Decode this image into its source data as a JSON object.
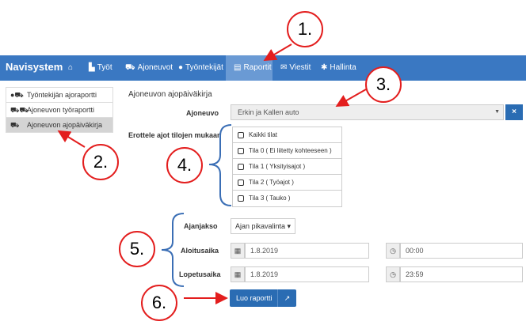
{
  "navbar": {
    "brand": "Navisystem",
    "items": [
      {
        "label": "",
        "icon": "home-icon",
        "glyph": "⌂"
      },
      {
        "label": "Työt",
        "icon": "chart-icon",
        "glyph": "▙"
      },
      {
        "label": "Ajoneuvot",
        "icon": "truck-icon",
        "glyph": "⛟"
      },
      {
        "label": "Työntekijät",
        "icon": "user-icon",
        "glyph": "●"
      },
      {
        "label": "Raportit",
        "icon": "document-icon",
        "glyph": "▤"
      },
      {
        "label": "Viestit",
        "icon": "envelope-icon",
        "glyph": "✉"
      },
      {
        "label": "Hallinta",
        "icon": "gear-icon",
        "glyph": "✱"
      }
    ],
    "active": "Raportit",
    "color": "#3a78c2"
  },
  "sidebar": {
    "items": [
      {
        "label": "Työntekijän ajoraportti",
        "icon": "user-truck-icon"
      },
      {
        "label": "Ajoneuvon työraportti",
        "icon": "truck-group-icon"
      },
      {
        "label": "Ajoneuvon ajopäiväkirja",
        "icon": "truck-icon"
      }
    ],
    "active": "Ajoneuvon ajopäiväkirja"
  },
  "main": {
    "title": "Ajoneuvon ajopäiväkirja",
    "vehicle": {
      "label": "Ajoneuvo",
      "value": "Erkin ja Kallen auto",
      "clear": "×"
    },
    "status_filter": {
      "label": "Erottele ajot tilojen mukaan",
      "options": [
        "Kaikki tilat",
        "Tila 0 ( Ei liitetty kohteeseen )",
        "Tila 1 ( Yksityisajot )",
        "Tila 2 ( Työajot )",
        "Tila 3 ( Tauko )"
      ]
    },
    "period": {
      "label": "Ajanjakso",
      "value": "Ajan pikavalinta"
    },
    "start": {
      "label": "Aloitusaika",
      "date": "1.8.2019",
      "time": "00:00"
    },
    "end": {
      "label": "Lopetusaika",
      "date": "1.8.2019",
      "time": "23:59"
    },
    "submit": {
      "label": "Luo raportti",
      "icon": "external-link-icon"
    }
  },
  "annotations": {
    "callouts": [
      "1.",
      "2.",
      "3.",
      "4.",
      "5.",
      "6."
    ],
    "color": "#e31e1e"
  }
}
